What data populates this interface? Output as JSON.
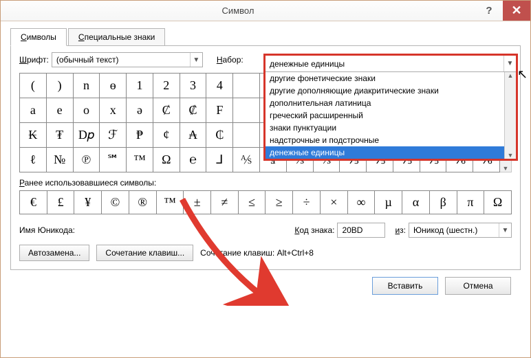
{
  "title": "Символ",
  "tabs": {
    "symbols": "Символы",
    "special": "Специальные знаки"
  },
  "font_label": "Шрифт:",
  "font_value": "(обычный текст)",
  "set_label": "Набор:",
  "set_value": "денежные единицы",
  "dropdown": {
    "items": [
      "другие фонетические знаки",
      "другие дополняющие диакритические знаки",
      "дополнительная латиница",
      "греческий расширенный",
      "знаки пунктуации",
      "надстрочные и подстрочные",
      "денежные единицы"
    ],
    "selected_index": 6
  },
  "grid_rows": [
    [
      "(",
      ")",
      "n",
      "ɵ",
      "1",
      "2",
      "3",
      "4",
      "",
      "",
      "",
      "",
      "",
      "",
      "",
      ""
    ],
    [
      "a",
      "e",
      "o",
      "x",
      "ə",
      "Ȼ",
      "₡",
      "F",
      "",
      "",
      "",
      "",
      "",
      "",
      "",
      ""
    ],
    [
      "₭",
      "₮",
      "D𝑝",
      "ℱ",
      "₱",
      "¢",
      "₳",
      "₵",
      "",
      "",
      "",
      "",
      "",
      "",
      "",
      ""
    ],
    [
      "ℓ",
      "№",
      "℗",
      "℠",
      "™",
      "Ω",
      "℮",
      "⅃",
      "⅍",
      "ⅎ",
      "⅓",
      "⅔",
      "⅕",
      "⅖",
      "⅗",
      "⅘",
      "⅙",
      "⅚"
    ]
  ],
  "recent_label": "Ранее использовавшиеся символы:",
  "recent_row": [
    "€",
    "£",
    "¥",
    "©",
    "®",
    "™",
    "±",
    "≠",
    "≤",
    "≥",
    "÷",
    "×",
    "∞",
    "µ",
    "α",
    "β",
    "π",
    "Ω"
  ],
  "unicode_name_label": "Имя Юникода:",
  "code_label": "Код знака:",
  "code_value": "20BD",
  "from_label": "из:",
  "from_value": "Юникод (шестн.)",
  "autocorrect_btn": "Автозамена...",
  "shortcut_btn": "Сочетание клавиш...",
  "shortcut_label": "Сочетание клавиш: Alt+Ctrl+8",
  "insert_btn": "Вставить",
  "cancel_btn": "Отмена"
}
